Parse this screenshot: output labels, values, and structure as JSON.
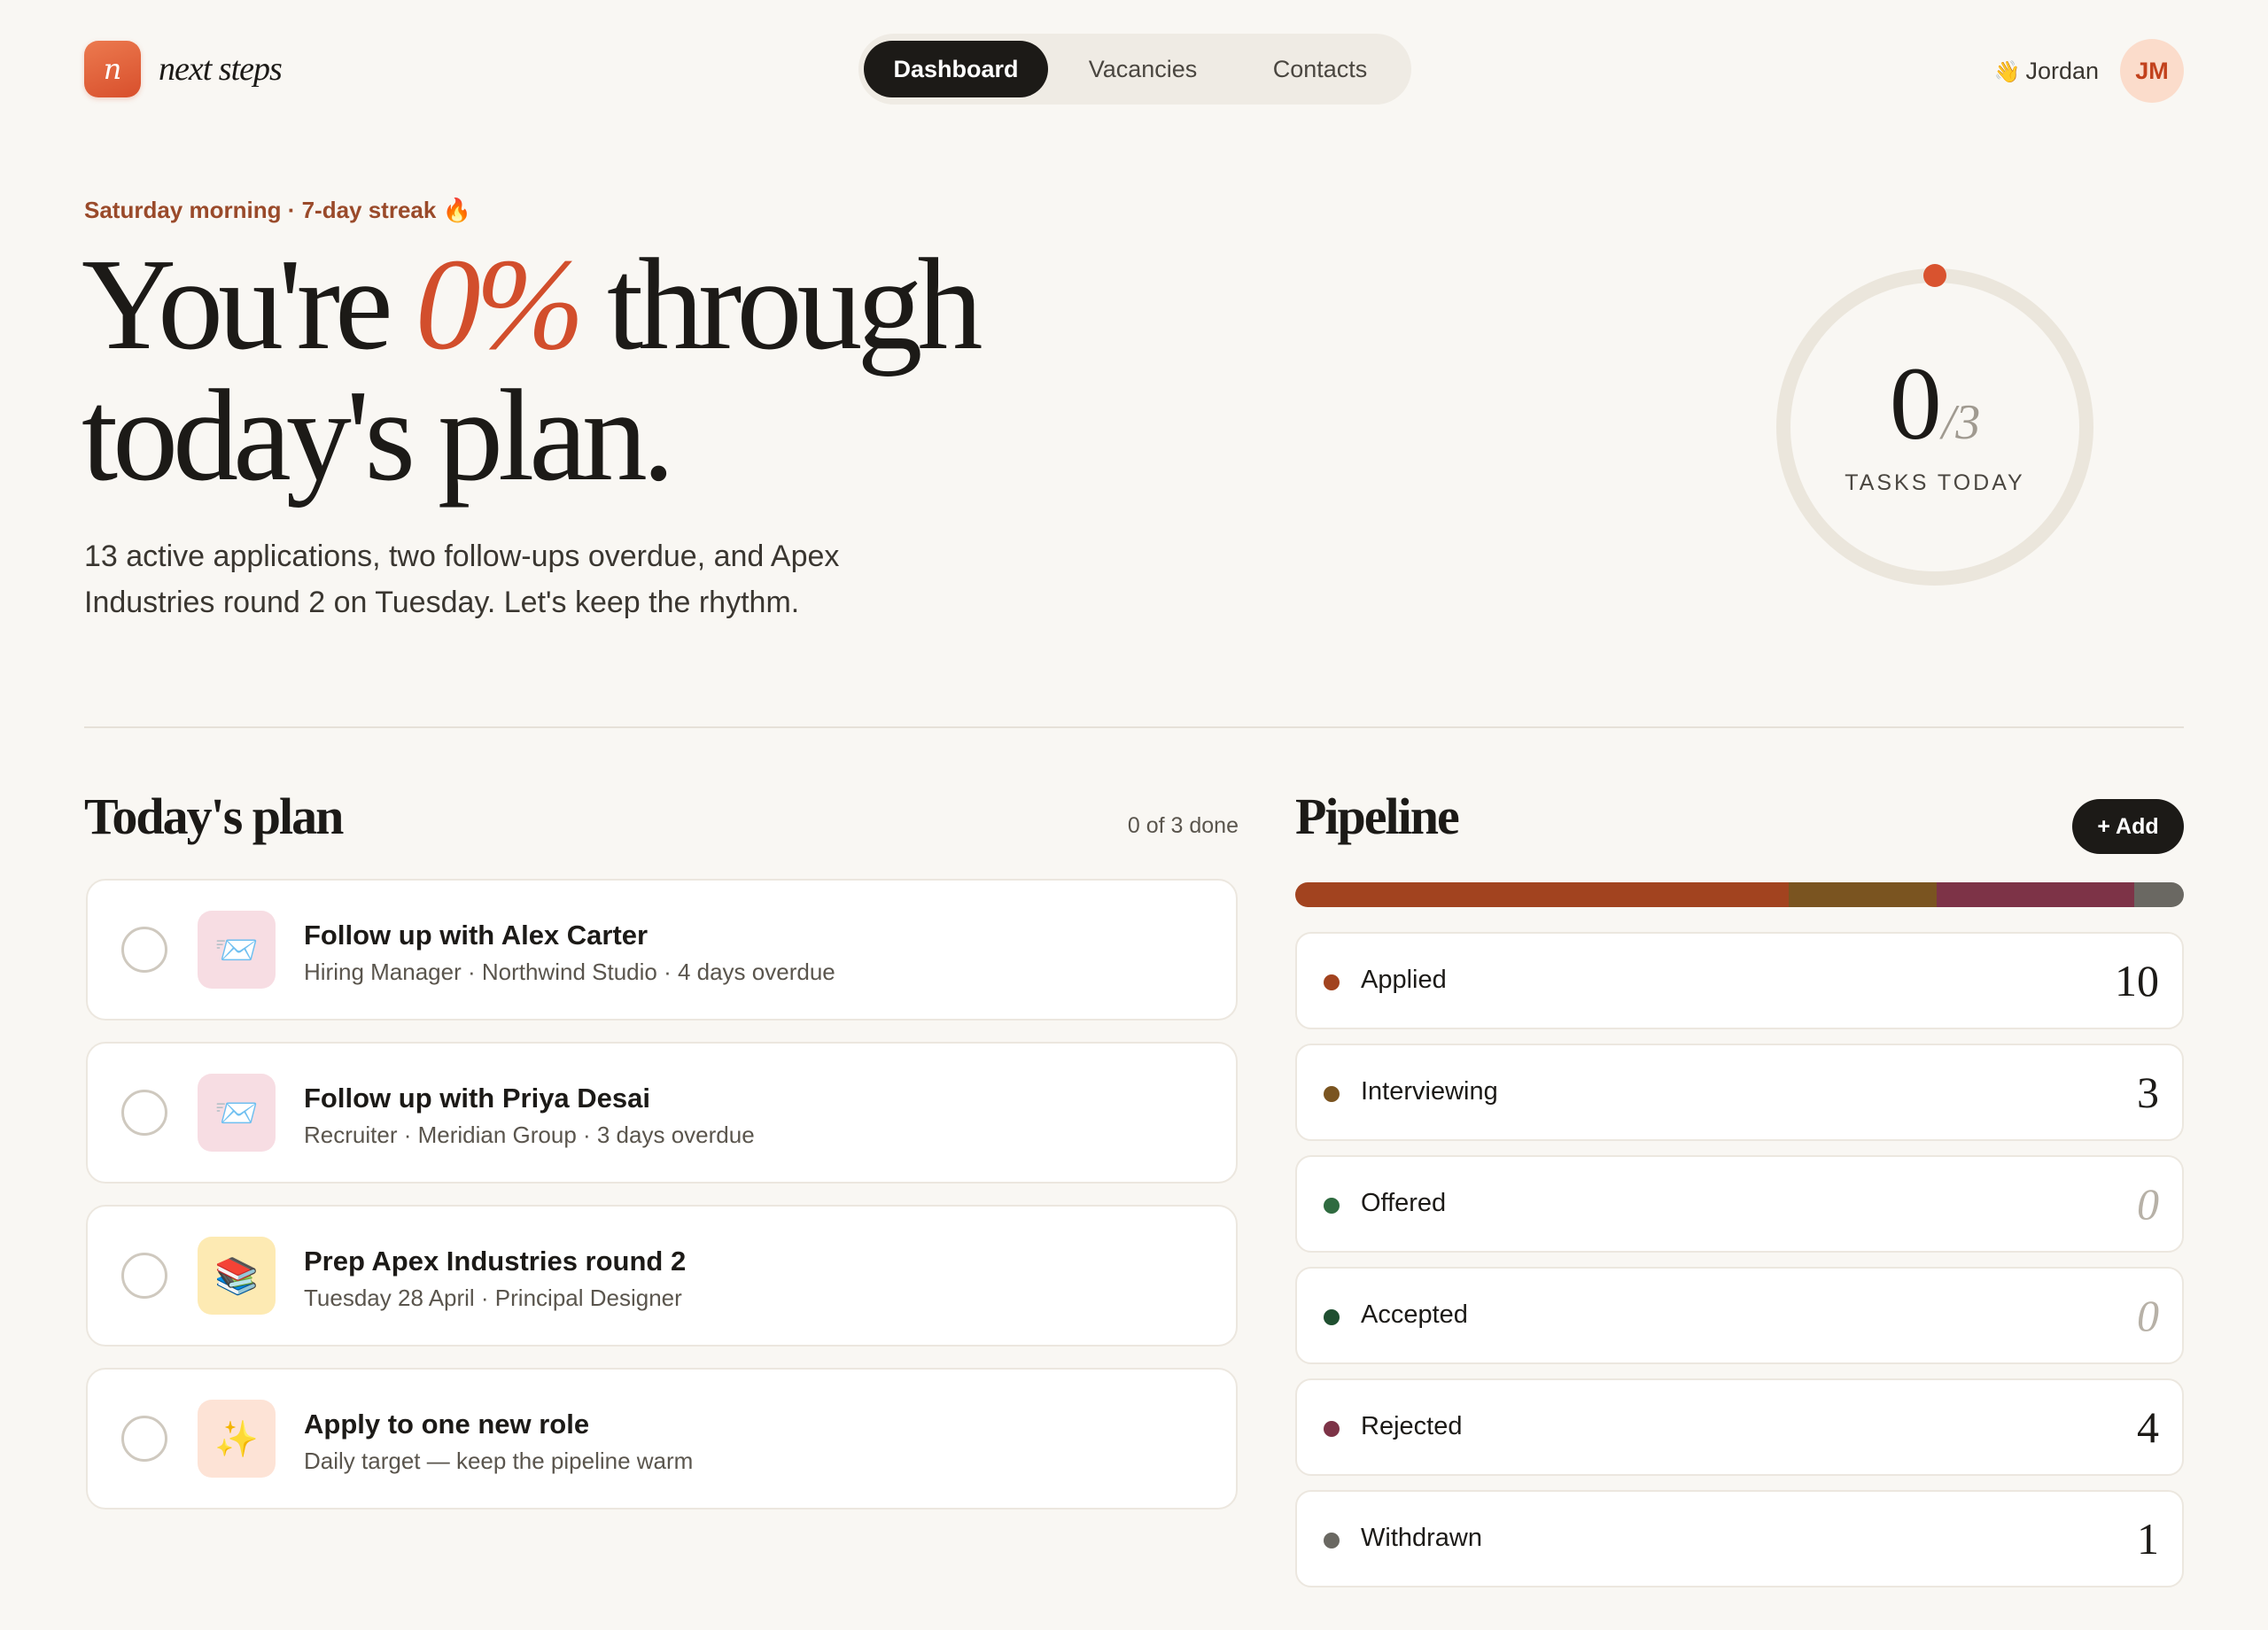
{
  "brand": {
    "mark": "n",
    "name": "next steps"
  },
  "nav": {
    "tabs": [
      "Dashboard",
      "Vacancies",
      "Contacts"
    ],
    "active": "Dashboard"
  },
  "user": {
    "wave_icon": "👋",
    "name": "Jordan",
    "initials": "JM"
  },
  "hero": {
    "eyebrow": "Saturday morning · 7-day streak 🔥",
    "headline_pre": "You're ",
    "headline_pct": "0%",
    "headline_post": " through today's plan.",
    "subcopy": "13 active applications, two follow-ups overdue, and Apex Industries round 2 on Tuesday. Let's keep the rhythm."
  },
  "tasks_ring": {
    "done": 0,
    "total": 3,
    "done_label": "0",
    "total_label": "/3",
    "label": "TASKS TODAY",
    "progress": 0
  },
  "plan": {
    "title": "Today's plan",
    "meta": "0 of 3 done",
    "tasks": [
      {
        "icon": "envelope-icon",
        "glyph": "📨",
        "bg": "#f7dde3",
        "title": "Follow up with Alex Carter",
        "sub": "Hiring Manager · Northwind Studio · 4 days overdue"
      },
      {
        "icon": "envelope-icon",
        "glyph": "📨",
        "bg": "#f7dde3",
        "title": "Follow up with Priya Desai",
        "sub": "Recruiter · Meridian Group · 3 days overdue"
      },
      {
        "icon": "books-icon",
        "glyph": "📚",
        "bg": "#fdeab3",
        "title": "Prep Apex Industries round 2",
        "sub": "Tuesday 28 April · Principal Designer"
      },
      {
        "icon": "sparkles-icon",
        "glyph": "✨",
        "bg": "#fde3d6",
        "title": "Apply to one new role",
        "sub": "Daily target — keep the pipeline warm"
      }
    ]
  },
  "pipeline": {
    "title": "Pipeline",
    "add_label": "+ Add",
    "stages": [
      {
        "name": "Applied",
        "count": "10",
        "value": 10,
        "color": "#a2431f"
      },
      {
        "name": "Interviewing",
        "count": "3",
        "value": 3,
        "color": "#7a5420"
      },
      {
        "name": "Offered",
        "count": "0",
        "value": 0,
        "color": "#2f6b40"
      },
      {
        "name": "Accepted",
        "count": "0",
        "value": 0,
        "color": "#1f4f30"
      },
      {
        "name": "Rejected",
        "count": "4",
        "value": 4,
        "color": "#7d3347"
      },
      {
        "name": "Withdrawn",
        "count": "1",
        "value": 1,
        "color": "#6a6862"
      }
    ]
  }
}
